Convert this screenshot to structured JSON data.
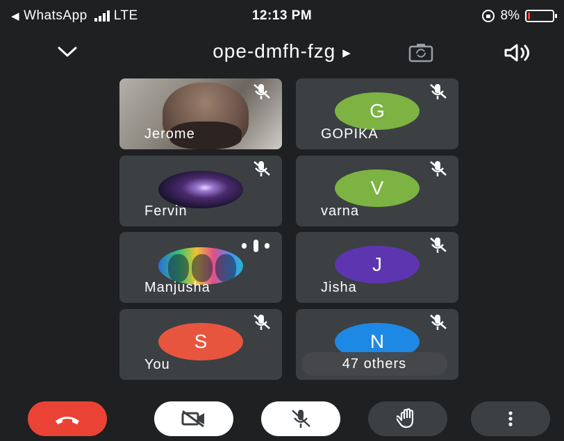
{
  "status_bar": {
    "back_app": "WhatsApp",
    "network": "LTE",
    "time": "12:13 PM",
    "battery": "8%",
    "battery_level": 0.08
  },
  "meeting": {
    "code": "ope-dmfh-fzg"
  },
  "participants": [
    {
      "name": "Jerome",
      "type": "video",
      "muted": true
    },
    {
      "name": "GOPIKA",
      "initial": "G",
      "avatar_color": "#7cb342",
      "muted": true
    },
    {
      "name": "Fervin",
      "type": "photo",
      "muted": true
    },
    {
      "name": "varna",
      "initial": "V",
      "avatar_color": "#7cb342",
      "muted": true
    },
    {
      "name": "Manjusha",
      "type": "photo",
      "speaking": true
    },
    {
      "name": "Jisha",
      "initial": "J",
      "avatar_color": "#5e35b1",
      "muted": true
    },
    {
      "name": "You",
      "initial": "S",
      "avatar_color": "#e8553e",
      "muted": true
    },
    {
      "name": "47 others",
      "initial": "N",
      "avatar_color": "#1e88e5",
      "muted": true
    }
  ],
  "controls": [
    {
      "name": "end-call",
      "icon": "phone-hangup-icon",
      "color": "#ea4335"
    },
    {
      "name": "camera-off",
      "icon": "video-off-icon",
      "color": "#ffffff"
    },
    {
      "name": "mic-off",
      "icon": "mic-off-icon",
      "color": "#ffffff"
    },
    {
      "name": "raise-hand",
      "icon": "hand-icon",
      "color": "#3c4043"
    },
    {
      "name": "more-options",
      "icon": "more-vert-icon",
      "color": "#3c4043"
    }
  ],
  "colors": {
    "background": "#1f2022",
    "tile": "#3c4043"
  }
}
